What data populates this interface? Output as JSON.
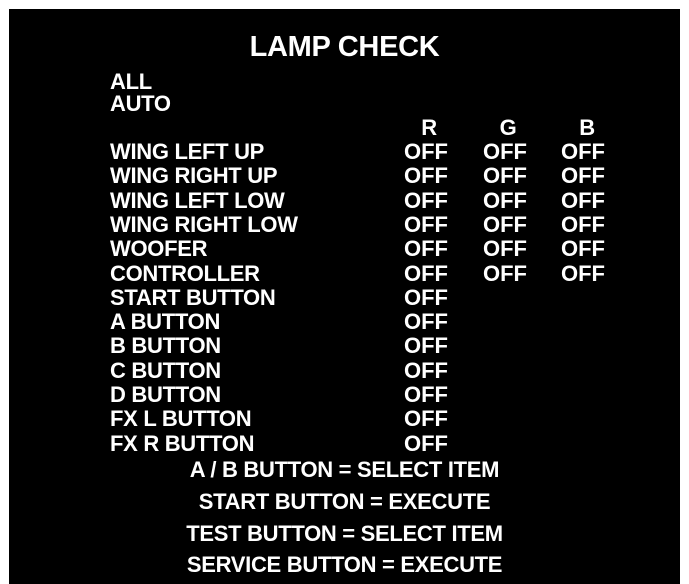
{
  "title": "LAMP CHECK",
  "modes": [
    "ALL",
    "AUTO"
  ],
  "columns": [
    "R",
    "G",
    "B"
  ],
  "rows": [
    {
      "name": "WING LEFT UP",
      "r": "OFF",
      "g": "OFF",
      "b": "OFF"
    },
    {
      "name": "WING RIGHT UP",
      "r": "OFF",
      "g": "OFF",
      "b": "OFF"
    },
    {
      "name": "WING LEFT LOW",
      "r": "OFF",
      "g": "OFF",
      "b": "OFF"
    },
    {
      "name": "WING RIGHT LOW",
      "r": "OFF",
      "g": "OFF",
      "b": "OFF"
    },
    {
      "name": "WOOFER",
      "r": "OFF",
      "g": "OFF",
      "b": "OFF"
    },
    {
      "name": "CONTROLLER",
      "r": "OFF",
      "g": "OFF",
      "b": "OFF"
    },
    {
      "name": "START BUTTON",
      "r": "OFF"
    },
    {
      "name": "A BUTTON",
      "r": "OFF"
    },
    {
      "name": "B BUTTON",
      "r": "OFF"
    },
    {
      "name": "C BUTTON",
      "r": "OFF"
    },
    {
      "name": "D BUTTON",
      "r": "OFF"
    },
    {
      "name": "FX L BUTTON",
      "r": "OFF"
    },
    {
      "name": "FX R BUTTON",
      "r": "OFF"
    }
  ],
  "instructions": [
    "A / B BUTTON = SELECT ITEM",
    "START BUTTON = EXECUTE",
    "TEST BUTTON = SELECT ITEM",
    "SERVICE BUTTON = EXECUTE"
  ],
  "colors": {
    "background": "#000000",
    "text": "#ffffff"
  }
}
